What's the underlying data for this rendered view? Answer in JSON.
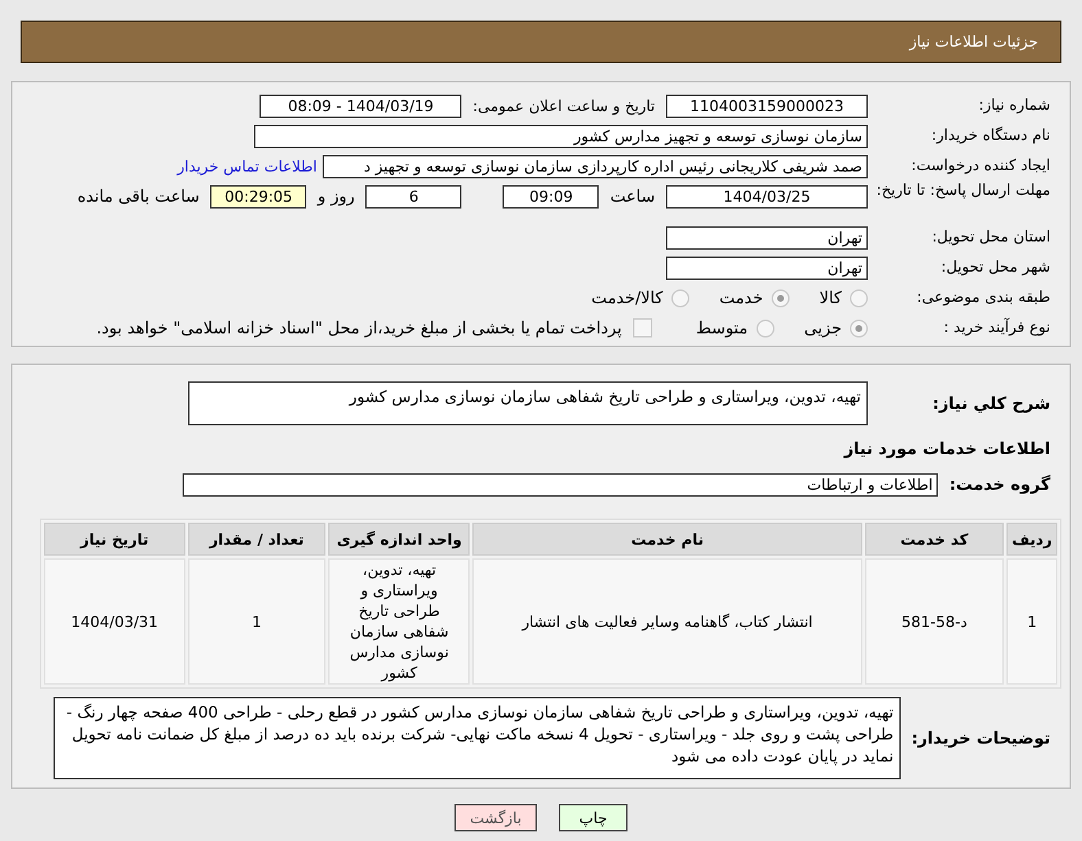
{
  "header": {
    "title": "جزئیات اطلاعات نیاز"
  },
  "need_number": {
    "label": "شماره نیاز:",
    "value": "1104003159000023"
  },
  "announce": {
    "label": "تاریخ و ساعت اعلان عمومی:",
    "value": "1404/03/19 - 08:09"
  },
  "buyer_org": {
    "label": "نام دستگاه خریدار:",
    "value": "سازمان نوسازی  توسعه و تجهیز مدارس کشور"
  },
  "creator": {
    "label": "ایجاد کننده درخواست:",
    "value": "صمد شریفی کلاریجانی رئیس اداره کارپردازی سازمان نوسازی  توسعه و تجهیز د",
    "link": "اطلاعات تماس خریدار"
  },
  "deadline": {
    "label": "مهلت ارسال پاسخ: تا تاریخ:",
    "date": "1404/03/25",
    "time_label": "ساعت",
    "time": "09:09",
    "days": "6",
    "days_label": "روز و",
    "remaining": "00:29:05",
    "remaining_label": "ساعت باقی مانده"
  },
  "province": {
    "label": "استان محل تحویل:",
    "value": "تهران"
  },
  "city": {
    "label": "شهر محل تحویل:",
    "value": "تهران"
  },
  "category": {
    "label": "طبقه بندی موضوعی:",
    "options": [
      {
        "label": "کالا",
        "selected": false
      },
      {
        "label": "خدمت",
        "selected": true
      },
      {
        "label": "کالا/خدمت",
        "selected": false
      }
    ]
  },
  "process": {
    "label": "نوع فرآیند خرید :",
    "options": [
      {
        "label": "جزیی",
        "selected": true
      },
      {
        "label": "متوسط",
        "selected": false
      }
    ],
    "payment": {
      "label": "پرداخت تمام یا بخشی از مبلغ خرید،از محل \"اسناد خزانه اسلامی\" خواهد بود.",
      "checked": false
    }
  },
  "summary": {
    "label": "شرح کلي نیاز:",
    "value": "تهیه، تدوین، ویراستاری و طراحی تاریخ شفاهی سازمان نوسازی مدارس کشور"
  },
  "services_title": "اطلاعات خدمات مورد نیاز",
  "service_group": {
    "label": "گروه خدمت:",
    "value": "اطلاعات و ارتباطات"
  },
  "table": {
    "columns": [
      "ردیف",
      "کد خدمت",
      "نام خدمت",
      "واحد اندازه گیری",
      "تعداد / مقدار",
      "تاریخ نیاز"
    ],
    "rows": [
      [
        "1",
        "د-58-581",
        "انتشار کتاب، گاهنامه وسایر فعالیت های انتشار",
        "تهیه، تدوین، ویراستاری و طراحی تاریخ شفاهی سازمان نوسازی مدارس کشور",
        "1",
        "1404/03/31"
      ]
    ]
  },
  "buyer_notes": {
    "label": "توضیحات خریدار:",
    "value": "تهیه، تدوین، ویراستاری و طراحی تاریخ شفاهی سازمان نوسازی مدارس کشور در قطع رحلی - طراحی 400 صفحه چهار رنگ - طراحی پشت و روی جلد - ویراستاری - تحویل 4 نسخه ماکت نهایی- شرکت برنده باید ده درصد از مبلغ کل ضمانت نامه تحویل نماید در پایان عودت داده می شود"
  },
  "buttons": [
    {
      "kind": "print",
      "label": "چاپ"
    },
    {
      "kind": "back",
      "label": "بازگشت"
    }
  ]
}
